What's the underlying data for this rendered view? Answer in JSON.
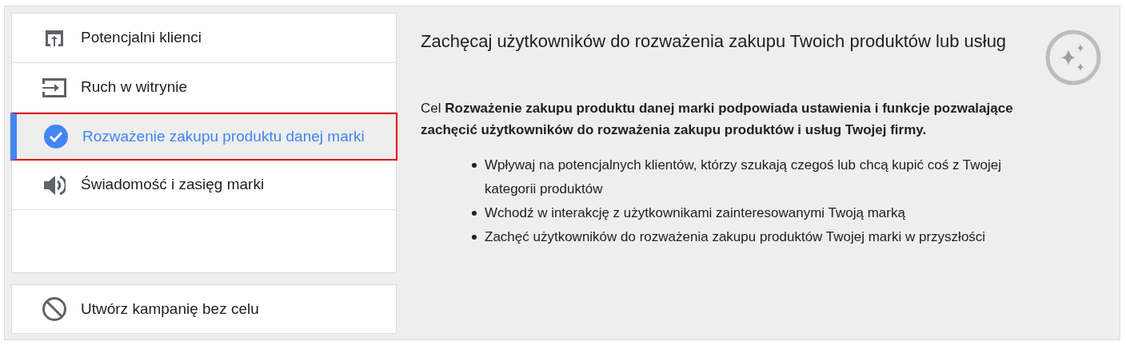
{
  "goals": [
    {
      "kind": "upload",
      "label": "Potencjalni klienci",
      "selected": false
    },
    {
      "kind": "enter",
      "label": "Ruch w witrynie",
      "selected": false
    },
    {
      "kind": "check",
      "label": "Rozważenie zakupu produktu danej marki",
      "selected": true
    },
    {
      "kind": "speaker",
      "label": "Świadomość i zasięg marki",
      "selected": false
    }
  ],
  "no_goal": {
    "kind": "block",
    "label": "Utwórz kampanię bez celu"
  },
  "detail": {
    "title": "Zachęcaj użytkowników do rozważenia zakupu Twoich produktów lub usług",
    "description": "Cel **Rozważenie zakupu produktu danej marki podpowiada ustawienia i funkcje pozwalające zachęcić użytkowników do rozważenia zakupu produktów i usług Twojej firmy.**",
    "bullets": [
      "Wpływaj na potencjalnych klientów, którzy szukają czegoś lub chcą kupić coś z Twojej kategorii produktów",
      "Wchodź w interakcję z użytkownikami zainteresowanymi Twoją marką",
      "Zachęć użytkowników do rozważenia zakupu produktów Twojej marki w przyszłości"
    ]
  }
}
